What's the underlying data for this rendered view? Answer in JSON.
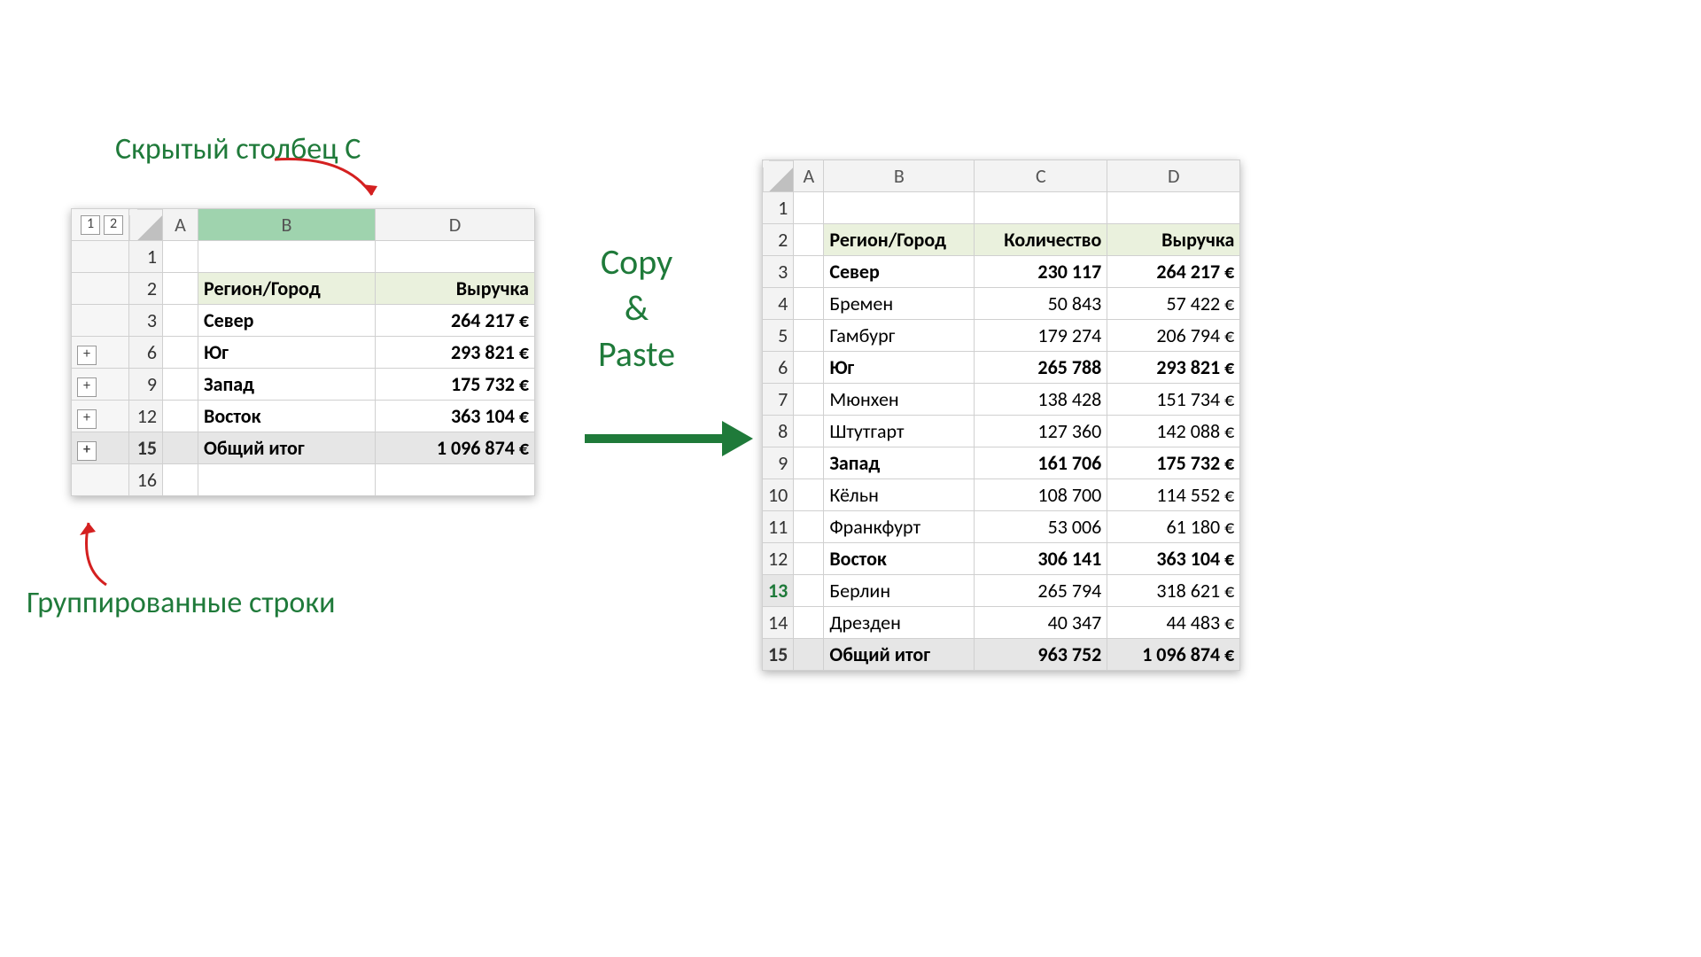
{
  "annotations": {
    "hidden_col": "Скрытый столбец С",
    "grouped_rows": "Группированные строки",
    "copy_paste_line1": "Copy",
    "copy_paste_line2": "&",
    "copy_paste_line3": "Paste"
  },
  "left": {
    "columns": [
      "A",
      "B",
      "D"
    ],
    "outline_levels": [
      "1",
      "2"
    ],
    "rows": [
      {
        "num": "1",
        "plus": false,
        "b": "",
        "d": ""
      },
      {
        "num": "2",
        "plus": false,
        "b": "Регион/Город",
        "d": "Выручка",
        "header": true
      },
      {
        "num": "3",
        "plus": false,
        "b": "Север",
        "d": "264 217 €",
        "bold": true
      },
      {
        "num": "6",
        "plus": true,
        "b": "Юг",
        "d": "293 821 €",
        "bold": true
      },
      {
        "num": "9",
        "plus": true,
        "b": "Запад",
        "d": "175 732 €",
        "bold": true
      },
      {
        "num": "12",
        "plus": true,
        "b": "Восток",
        "d": "363 104 €",
        "bold": true
      },
      {
        "num": "15",
        "plus": true,
        "b": "Общий итог",
        "d": "1 096 874 €",
        "total": true
      },
      {
        "num": "16",
        "plus": false,
        "b": "",
        "d": ""
      }
    ]
  },
  "right": {
    "columns": [
      "A",
      "B",
      "C",
      "D"
    ],
    "headers": {
      "b": "Регион/Город",
      "c": "Количество",
      "d": "Выручка"
    },
    "rows": [
      {
        "num": "1"
      },
      {
        "num": "2",
        "b": "Регион/Город",
        "c": "Количество",
        "d": "Выручка",
        "header": true
      },
      {
        "num": "3",
        "b": "Север",
        "c": "230 117",
        "d": "264 217 €",
        "bold": true
      },
      {
        "num": "4",
        "b": "Бремен",
        "c": "50 843",
        "d": "57 422 €",
        "indent": true
      },
      {
        "num": "5",
        "b": "Гамбург",
        "c": "179 274",
        "d": "206 794 €",
        "indent": true
      },
      {
        "num": "6",
        "b": "Юг",
        "c": "265 788",
        "d": "293 821 €",
        "bold": true
      },
      {
        "num": "7",
        "b": "Мюнхен",
        "c": "138 428",
        "d": "151 734 €",
        "indent": true
      },
      {
        "num": "8",
        "b": "Штутгарт",
        "c": "127 360",
        "d": "142 088 €",
        "indent": true
      },
      {
        "num": "9",
        "b": "Запад",
        "c": "161 706",
        "d": "175 732 €",
        "bold": true
      },
      {
        "num": "10",
        "b": "Кёльн",
        "c": "108 700",
        "d": "114 552 €",
        "indent": true
      },
      {
        "num": "11",
        "b": "Франкфурт",
        "c": "53 006",
        "d": "61 180 €",
        "indent": true
      },
      {
        "num": "12",
        "b": "Восток",
        "c": "306 141",
        "d": "363 104 €",
        "bold": true
      },
      {
        "num": "13",
        "b": "Берлин",
        "c": "265 794",
        "d": "318 621 €",
        "indent": true,
        "selrow": true
      },
      {
        "num": "14",
        "b": "Дрезден",
        "c": "40 347",
        "d": "44 483 €",
        "indent": true
      },
      {
        "num": "15",
        "b": "Общий итог",
        "c": "963 752",
        "d": "1 096 874 €",
        "total": true
      }
    ]
  },
  "chart_data": {
    "type": "table",
    "tables": [
      {
        "title": "Collapsed view (hidden column C, grouped rows)",
        "columns": [
          "Регион/Город",
          "Выручка"
        ],
        "rows": [
          [
            "Север",
            "264 217 €"
          ],
          [
            "Юг",
            "293 821 €"
          ],
          [
            "Запад",
            "175 732 €"
          ],
          [
            "Восток",
            "363 104 €"
          ],
          [
            "Общий итог",
            "1 096 874 €"
          ]
        ]
      },
      {
        "title": "Expanded paste result",
        "columns": [
          "Регион/Город",
          "Количество",
          "Выручка"
        ],
        "rows": [
          [
            "Север",
            "230 117",
            "264 217 €"
          ],
          [
            "Бремен",
            "50 843",
            "57 422 €"
          ],
          [
            "Гамбург",
            "179 274",
            "206 794 €"
          ],
          [
            "Юг",
            "265 788",
            "293 821 €"
          ],
          [
            "Мюнхен",
            "138 428",
            "151 734 €"
          ],
          [
            "Штутгарт",
            "127 360",
            "142 088 €"
          ],
          [
            "Запад",
            "161 706",
            "175 732 €"
          ],
          [
            "Кёльн",
            "108 700",
            "114 552 €"
          ],
          [
            "Франкфурт",
            "53 006",
            "61 180 €"
          ],
          [
            "Восток",
            "306 141",
            "363 104 €"
          ],
          [
            "Берлин",
            "265 794",
            "318 621 €"
          ],
          [
            "Дрезден",
            "40 347",
            "44 483 €"
          ],
          [
            "Общий итог",
            "963 752",
            "1 096 874 €"
          ]
        ]
      }
    ]
  }
}
